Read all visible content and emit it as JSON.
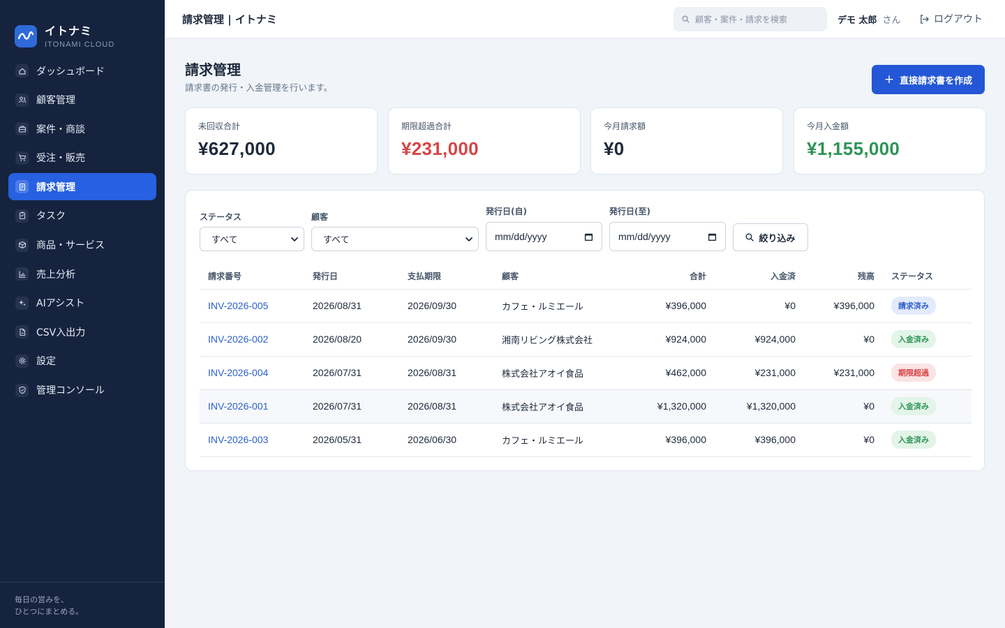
{
  "brand": {
    "name": "イトナミ",
    "sub": "ITONAMI CLOUD"
  },
  "nav": [
    {
      "label": "ダッシュボード",
      "icon": "home-icon"
    },
    {
      "label": "顧客管理",
      "icon": "users-icon"
    },
    {
      "label": "案件・商談",
      "icon": "briefcase-icon"
    },
    {
      "label": "受注・販売",
      "icon": "cart-icon"
    },
    {
      "label": "請求管理",
      "icon": "invoice-icon",
      "active": true
    },
    {
      "label": "タスク",
      "icon": "clipboard-icon"
    },
    {
      "label": "商品・サービス",
      "icon": "box-icon"
    },
    {
      "label": "売上分析",
      "icon": "bar-chart-icon"
    },
    {
      "label": "AIアシスト",
      "icon": "sparkle-icon"
    },
    {
      "label": "CSV入出力",
      "icon": "file-icon"
    },
    {
      "label": "設定",
      "icon": "gear-icon"
    },
    {
      "label": "管理コンソール",
      "icon": "shield-icon"
    }
  ],
  "sidebar_footer": {
    "line1": "毎日の営みを、",
    "line2": "ひとつにまとめる。"
  },
  "topbar": {
    "title": "請求管理 | イトナミ",
    "search_placeholder": "顧客・案件・請求を検索",
    "user_name": "デモ 太郎",
    "user_suffix": "さん",
    "logout": "ログアウト"
  },
  "page": {
    "title": "請求管理",
    "description": "請求書の発行・入金管理を行います。",
    "create_button": "直接請求書を作成"
  },
  "summary": [
    {
      "label": "未回収合計",
      "value": "¥627,000",
      "color": "#1e293b"
    },
    {
      "label": "期限超過合計",
      "value": "¥231,000",
      "color": "#d64545"
    },
    {
      "label": "今月請求額",
      "value": "¥0",
      "color": "#1e293b"
    },
    {
      "label": "今月入金額",
      "value": "¥1,155,000",
      "color": "#2e9456"
    }
  ],
  "filters": {
    "status_label": "ステータス",
    "status_value": "すべて",
    "customer_label": "顧客",
    "customer_value": "すべて",
    "date_from_label": "発行日(自)",
    "date_from_placeholder": "mm/dd/yyyy",
    "date_to_label": "発行日(至)",
    "date_to_placeholder": "mm/dd/yyyy",
    "submit": "絞り込み"
  },
  "table": {
    "headers": [
      "請求番号",
      "発行日",
      "支払期限",
      "顧客",
      "合計",
      "入金済",
      "残高",
      "ステータス"
    ],
    "rows": [
      {
        "id": "INV-2026-005",
        "issued": "2026/08/31",
        "due": "2026/09/30",
        "customer": "カフェ・ルミエール",
        "total": "¥396,000",
        "paid": "¥0",
        "balance": "¥396,000",
        "status": "請求済み",
        "status_bg": "#e3ebfb",
        "status_fg": "#2b5fc9"
      },
      {
        "id": "INV-2026-002",
        "issued": "2026/08/20",
        "due": "2026/09/30",
        "customer": "湘南リビング株式会社",
        "total": "¥924,000",
        "paid": "¥924,000",
        "balance": "¥0",
        "status": "入金済み",
        "status_bg": "#e3f4e8",
        "status_fg": "#2e9456"
      },
      {
        "id": "INV-2026-004",
        "issued": "2026/07/31",
        "due": "2026/08/31",
        "customer": "株式会社アオイ食品",
        "total": "¥462,000",
        "paid": "¥231,000",
        "balance": "¥231,000",
        "status": "期限超過",
        "status_bg": "#fbe4e4",
        "status_fg": "#d64545"
      },
      {
        "id": "INV-2026-001",
        "issued": "2026/07/31",
        "due": "2026/08/31",
        "customer": "株式会社アオイ食品",
        "total": "¥1,320,000",
        "paid": "¥1,320,000",
        "balance": "¥0",
        "status": "入金済み",
        "status_bg": "#e3f4e8",
        "status_fg": "#2e9456",
        "highlight": true
      },
      {
        "id": "INV-2026-003",
        "issued": "2026/05/31",
        "due": "2026/06/30",
        "customer": "カフェ・ルミエール",
        "total": "¥396,000",
        "paid": "¥396,000",
        "balance": "¥0",
        "status": "入金済み",
        "status_bg": "#e3f4e8",
        "status_fg": "#2e9456"
      }
    ]
  }
}
